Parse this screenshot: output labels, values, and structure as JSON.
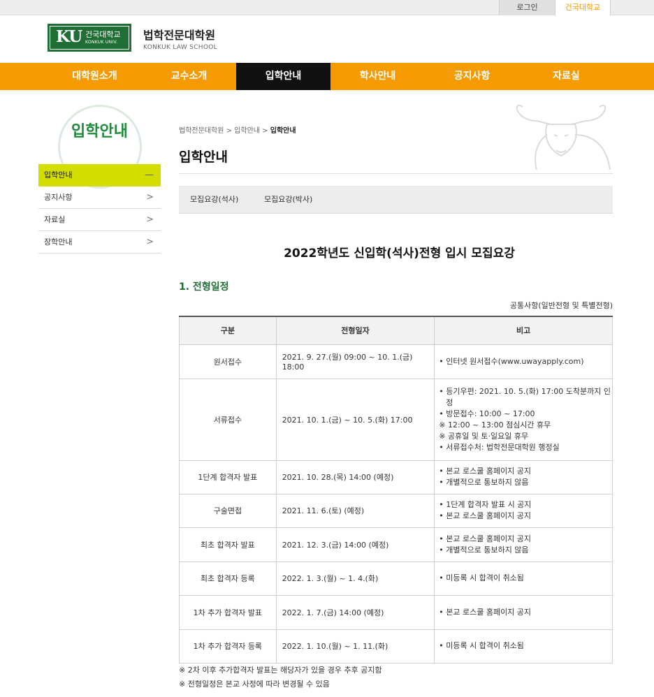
{
  "topbar": {
    "login": "로그인",
    "konkuk": "건국대학교"
  },
  "header": {
    "logo_ku": "KU",
    "logo_name": "건국대학교",
    "logo_univ": "KONKUK UNIV.",
    "school_name": "법학전문대학원",
    "school_en": "KONKUK LAW SCHOOL"
  },
  "gnb": [
    "대학원소개",
    "교수소개",
    "입학안내",
    "학사안내",
    "공지사항",
    "자료실"
  ],
  "lnb": {
    "title": "입학안내",
    "items": [
      {
        "label": "입학안내",
        "icon": "minus-icon"
      },
      {
        "label": "공지사항",
        "icon": "chevron-right-icon"
      },
      {
        "label": "자료실",
        "icon": "chevron-right-icon"
      },
      {
        "label": "장학안내",
        "icon": "chevron-right-icon"
      }
    ]
  },
  "breadcrumb": {
    "a": "법학전문대학원",
    "b": "입학안내",
    "current": "입학안내",
    "sep": ">"
  },
  "page_title": "입학안내",
  "subtabs": [
    "모집요강(석사)",
    "모집요강(박사)"
  ],
  "doc_title": "2022학년도 신입학(석사)전형 입시 모집요강",
  "section_title": "1. 전형일정",
  "common_note": "공통사항(일반전형 및 특별전형)",
  "table": {
    "headers": [
      "구분",
      "전형일자",
      "비고"
    ],
    "rows": [
      {
        "name": "원서접수",
        "date": "2021. 9. 27.(월) 09:00 ~ 10. 1.(금) 18:00",
        "notes": [
          "• 인터넷 원서접수(www.uwayapply.com)"
        ]
      },
      {
        "name": "서류접수",
        "date": "2021. 10. 1.(금) ~ 10. 5.(화) 17:00",
        "notes": [
          "• 등기우편: 2021. 10. 5.(화) 17:00 도착분까지 인정",
          "• 방문접수: 10:00 ~ 17:00",
          "※ 12:00 ~ 13:00 점심시간 휴무",
          "※ 공휴일 및 토·일요일 휴무",
          "• 서류접수처: 법학전문대학원 행정실"
        ]
      },
      {
        "name": "1단계 합격자 발표",
        "date": "2021. 10. 28.(목) 14:00 (예정)",
        "notes": [
          "• 본교 로스쿨 홈페이지 공지",
          "• 개별적으로 통보하지 않음"
        ]
      },
      {
        "name": "구술면접",
        "date": "2021. 11. 6.(토) (예정)",
        "notes": [
          "• 1단계 합격자 발표 시 공지",
          "• 본교 로스쿨 홈페이지 공지"
        ]
      },
      {
        "name": "최초 합격자 발표",
        "date": "2021. 12. 3.(금) 14:00 (예정)",
        "notes": [
          "• 본교 로스쿨 홈페이지 공지",
          "• 개별적으로 통보하지 않음"
        ]
      },
      {
        "name": "최초 합격자 등록",
        "date": "2022. 1. 3.(월) ~ 1. 4.(화)",
        "notes": [
          "• 미등록 시 합격이 취소됨"
        ]
      },
      {
        "name": "1차 추가 합격자 발표",
        "date": "2022. 1. 7.(금) 14:00 (예정)",
        "notes": [
          "• 본교 로스쿨 홈페이지 공지"
        ]
      },
      {
        "name": "1차 추가 합격자 등록",
        "date": "2022. 1. 10.(월) ~ 1. 11.(화)",
        "notes": [
          "• 미등록 시 합격이 취소됨"
        ]
      }
    ]
  },
  "footnotes": [
    "※ 2차 이후 추가합격자 발표는 해당자가 있을 경우 추후 공지함",
    "※ 전형일정은 본교 사정에 따라 변경될 수 있음"
  ],
  "colors": {
    "accent": "#f59a00",
    "green": "#1f6e33",
    "active_side": "#d4dd00"
  }
}
